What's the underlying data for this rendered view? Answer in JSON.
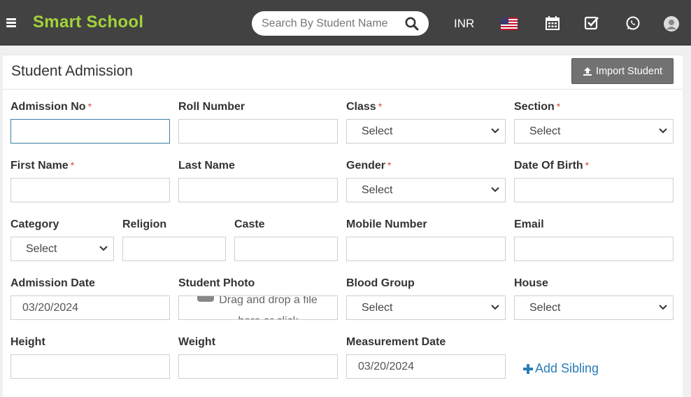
{
  "header": {
    "brand": "Smart School",
    "search_placeholder": "Search By Student Name",
    "currency": "INR",
    "icons": [
      "menu-icon",
      "search-icon",
      "us-flag-icon",
      "calendar-icon",
      "checkbox-icon",
      "whatsapp-icon",
      "user-avatar-icon"
    ]
  },
  "page": {
    "title": "Student Admission",
    "import_label": "Import Student"
  },
  "form": {
    "admission_no": {
      "label": "Admission No",
      "required": "*",
      "value": ""
    },
    "roll_number": {
      "label": "Roll Number",
      "value": ""
    },
    "class": {
      "label": "Class",
      "required": "*",
      "value": "Select"
    },
    "section": {
      "label": "Section",
      "required": "*",
      "value": "Select"
    },
    "first_name": {
      "label": "First Name",
      "required": "*",
      "value": ""
    },
    "last_name": {
      "label": "Last Name",
      "value": ""
    },
    "gender": {
      "label": "Gender",
      "required": "*",
      "value": "Select"
    },
    "dob": {
      "label": "Date Of Birth",
      "required": "*",
      "value": ""
    },
    "category": {
      "label": "Category",
      "value": "Select"
    },
    "religion": {
      "label": "Religion",
      "value": ""
    },
    "caste": {
      "label": "Caste",
      "value": ""
    },
    "mobile": {
      "label": "Mobile Number",
      "value": ""
    },
    "email": {
      "label": "Email",
      "value": ""
    },
    "admission_date": {
      "label": "Admission Date",
      "value": "03/20/2024"
    },
    "student_photo": {
      "label": "Student Photo",
      "drop_text_1": "Drag and drop a file",
      "drop_text_2": "here or click"
    },
    "blood_group": {
      "label": "Blood Group",
      "value": "Select"
    },
    "house": {
      "label": "House",
      "value": "Select"
    },
    "height": {
      "label": "Height",
      "value": ""
    },
    "weight": {
      "label": "Weight",
      "value": ""
    },
    "measurement_date": {
      "label": "Measurement Date",
      "value": "03/20/2024"
    },
    "add_sibling": "Add Sibling"
  },
  "colors": {
    "header_bg": "#424242",
    "brand": "#a3d33a",
    "link": "#2a7db8",
    "required": "#d9463f"
  }
}
